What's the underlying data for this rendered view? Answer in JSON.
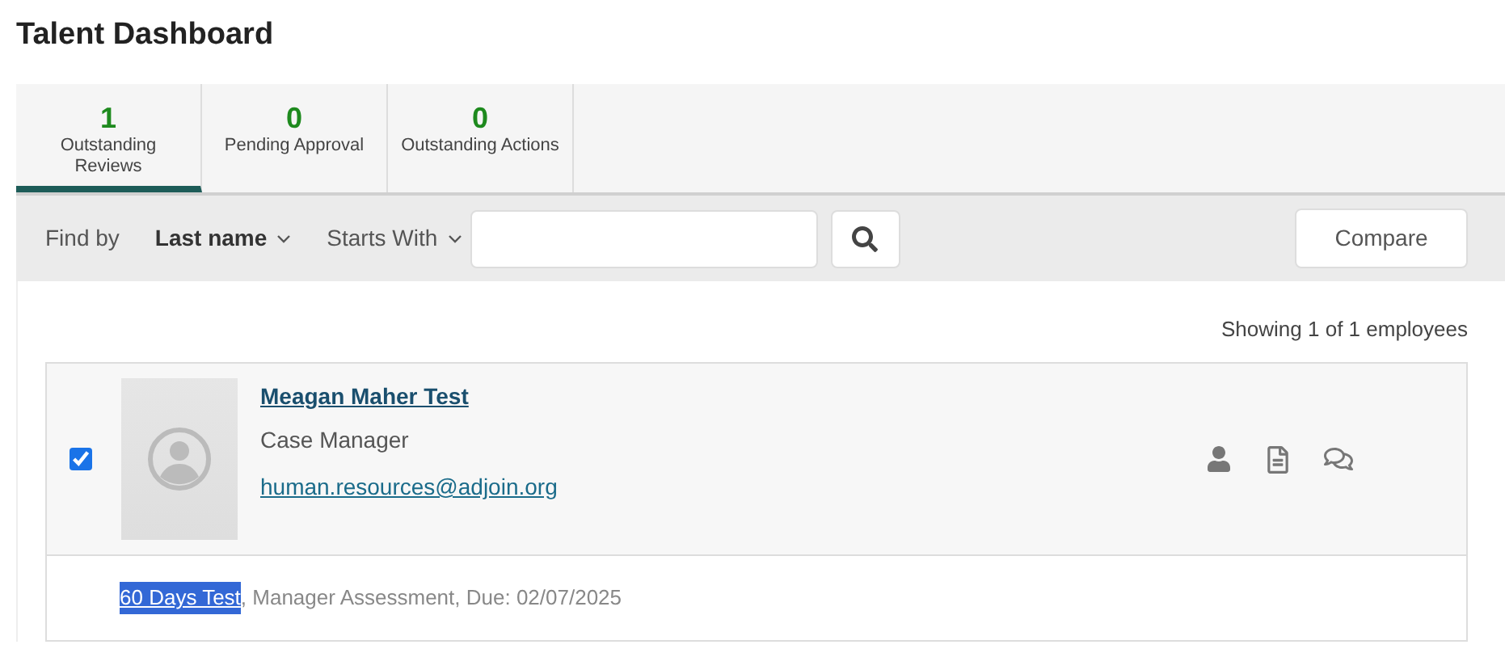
{
  "page": {
    "title": "Talent Dashboard"
  },
  "tabs": [
    {
      "count": "1",
      "label": "Outstanding Reviews",
      "selected": true
    },
    {
      "count": "0",
      "label": "Pending Approval",
      "selected": false
    },
    {
      "count": "0",
      "label": "Outstanding Actions",
      "selected": false
    }
  ],
  "toolbar": {
    "find_by_label": "Find by",
    "field_dropdown": "Last name",
    "match_dropdown": "Starts With",
    "compare_button": "Compare"
  },
  "result_count": "Showing 1 of 1 employees",
  "employees": [
    {
      "name": "Meagan Maher Test",
      "title": "Case Manager",
      "email": "human.resources@adjoin.org",
      "checked": true,
      "task": {
        "link": "60 Days Test",
        "highlighted": true,
        "details": ", Manager Assessment, Due: 02/07/2025"
      }
    }
  ]
}
